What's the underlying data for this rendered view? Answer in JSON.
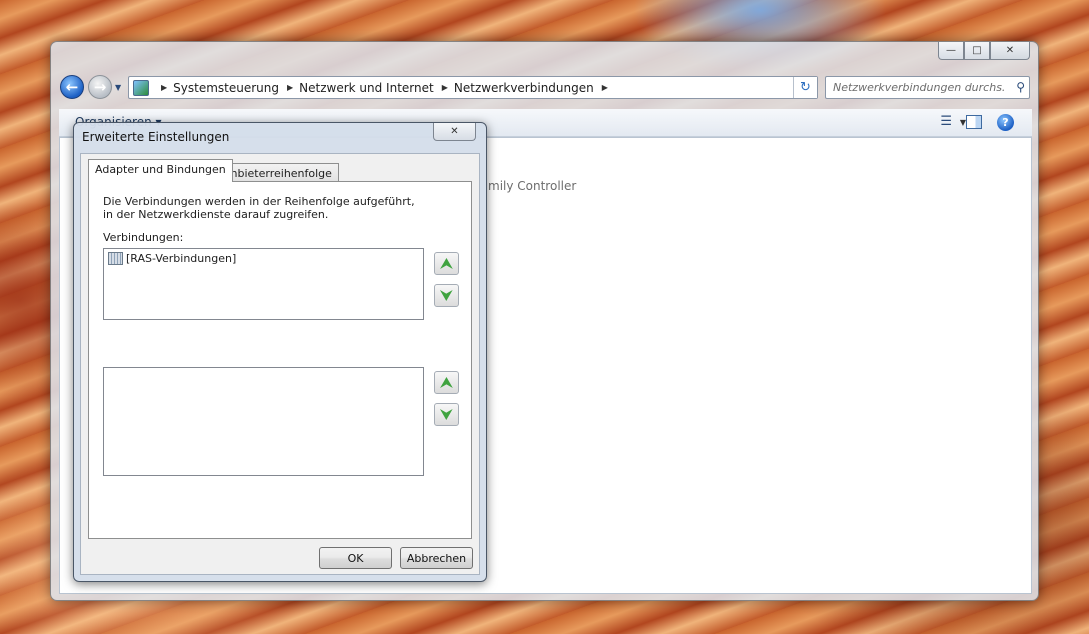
{
  "explorer": {
    "breadcrumbs": [
      {
        "label": "Systemsteuerung"
      },
      {
        "label": "Netzwerk und Internet"
      },
      {
        "label": "Netzwerkverbindungen"
      }
    ],
    "search_placeholder": "Netzwerkverbindungen durchs...",
    "toolbar": {
      "organize_label": "Organisieren ▾"
    },
    "partial_item_text": "mily Controller",
    "window_controls": {
      "minimize": "—",
      "maximize": "□",
      "close": "✕"
    }
  },
  "dialog": {
    "title": "Erweiterte Einstellungen",
    "close_glyph": "✕",
    "tabs": [
      {
        "label": "Adapter und Bindungen"
      },
      {
        "label": "Anbieterreihenfolge"
      }
    ],
    "description": "Die Verbindungen werden in der Reihenfolge aufgeführt, in der Netzwerkdienste darauf zugreifen.",
    "connections_label": "Verbindungen:",
    "connections": [
      {
        "label": "[RAS-Verbindungen]",
        "icon": "ras-connections-icon"
      }
    ],
    "move_up_glyph": "⮝",
    "move_down_glyph": "⮟",
    "ok_label": "OK",
    "cancel_label": "Abbrechen"
  },
  "icons": {
    "back": "back-arrow-icon",
    "forward": "forward-arrow-icon",
    "refresh": "refresh-icon",
    "search": "search-icon",
    "help": "help-icon"
  },
  "colors": {
    "accent_blue": "#1c5fc4",
    "arrow_green": "#3fa33f",
    "window_glass": "#dee4ec"
  }
}
